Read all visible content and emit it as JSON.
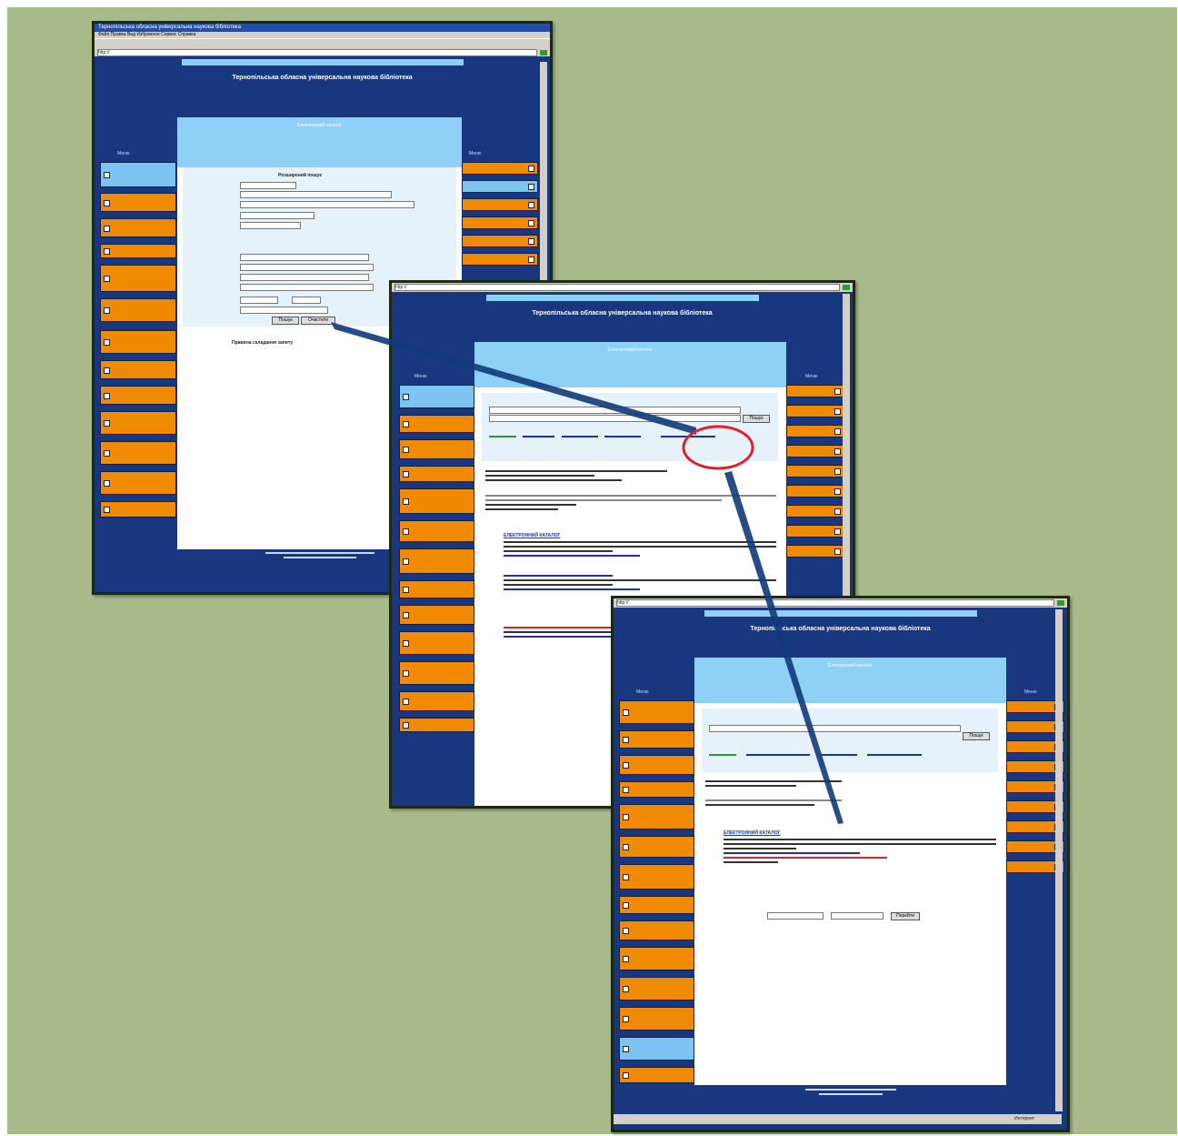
{
  "site_title": "Тернопільська обласна універсальна наукова бібліотека",
  "header_text": "Електронний каталог",
  "left_menu_heading": "Меню",
  "right_menu_heading": "Меню",
  "window1": {
    "title": "Тернопільська обласна універсальна наукова бібліотека",
    "menu": "Файл   Правка   Вид   Избранное   Сервис   Справка",
    "address": "http://",
    "form_heading": "Розширений пошук",
    "search_button": "Пошук",
    "reset_button": "Очистити",
    "notice": "Правила складання запиту"
  },
  "window2": {
    "address": "http://",
    "search_button": "Пошук",
    "result_link": "ЕЛЕКТРОННИЙ КАТАЛОГ"
  },
  "window3": {
    "address": "http://",
    "search_button": "Пошук",
    "result_link": "ЕЛЕКТРОННИЙ КАТАЛОГ",
    "go_button": "Перейти",
    "status_text": "Интернет"
  },
  "colors": {
    "page_background": "#a8b98a",
    "window_border": "#1c2a14",
    "site_blue": "#19377e",
    "light_blue": "#8fd0f6",
    "menu_orange": "#f08a00",
    "highlight_red": "#e0202a",
    "connector_blue": "#103a7a"
  }
}
